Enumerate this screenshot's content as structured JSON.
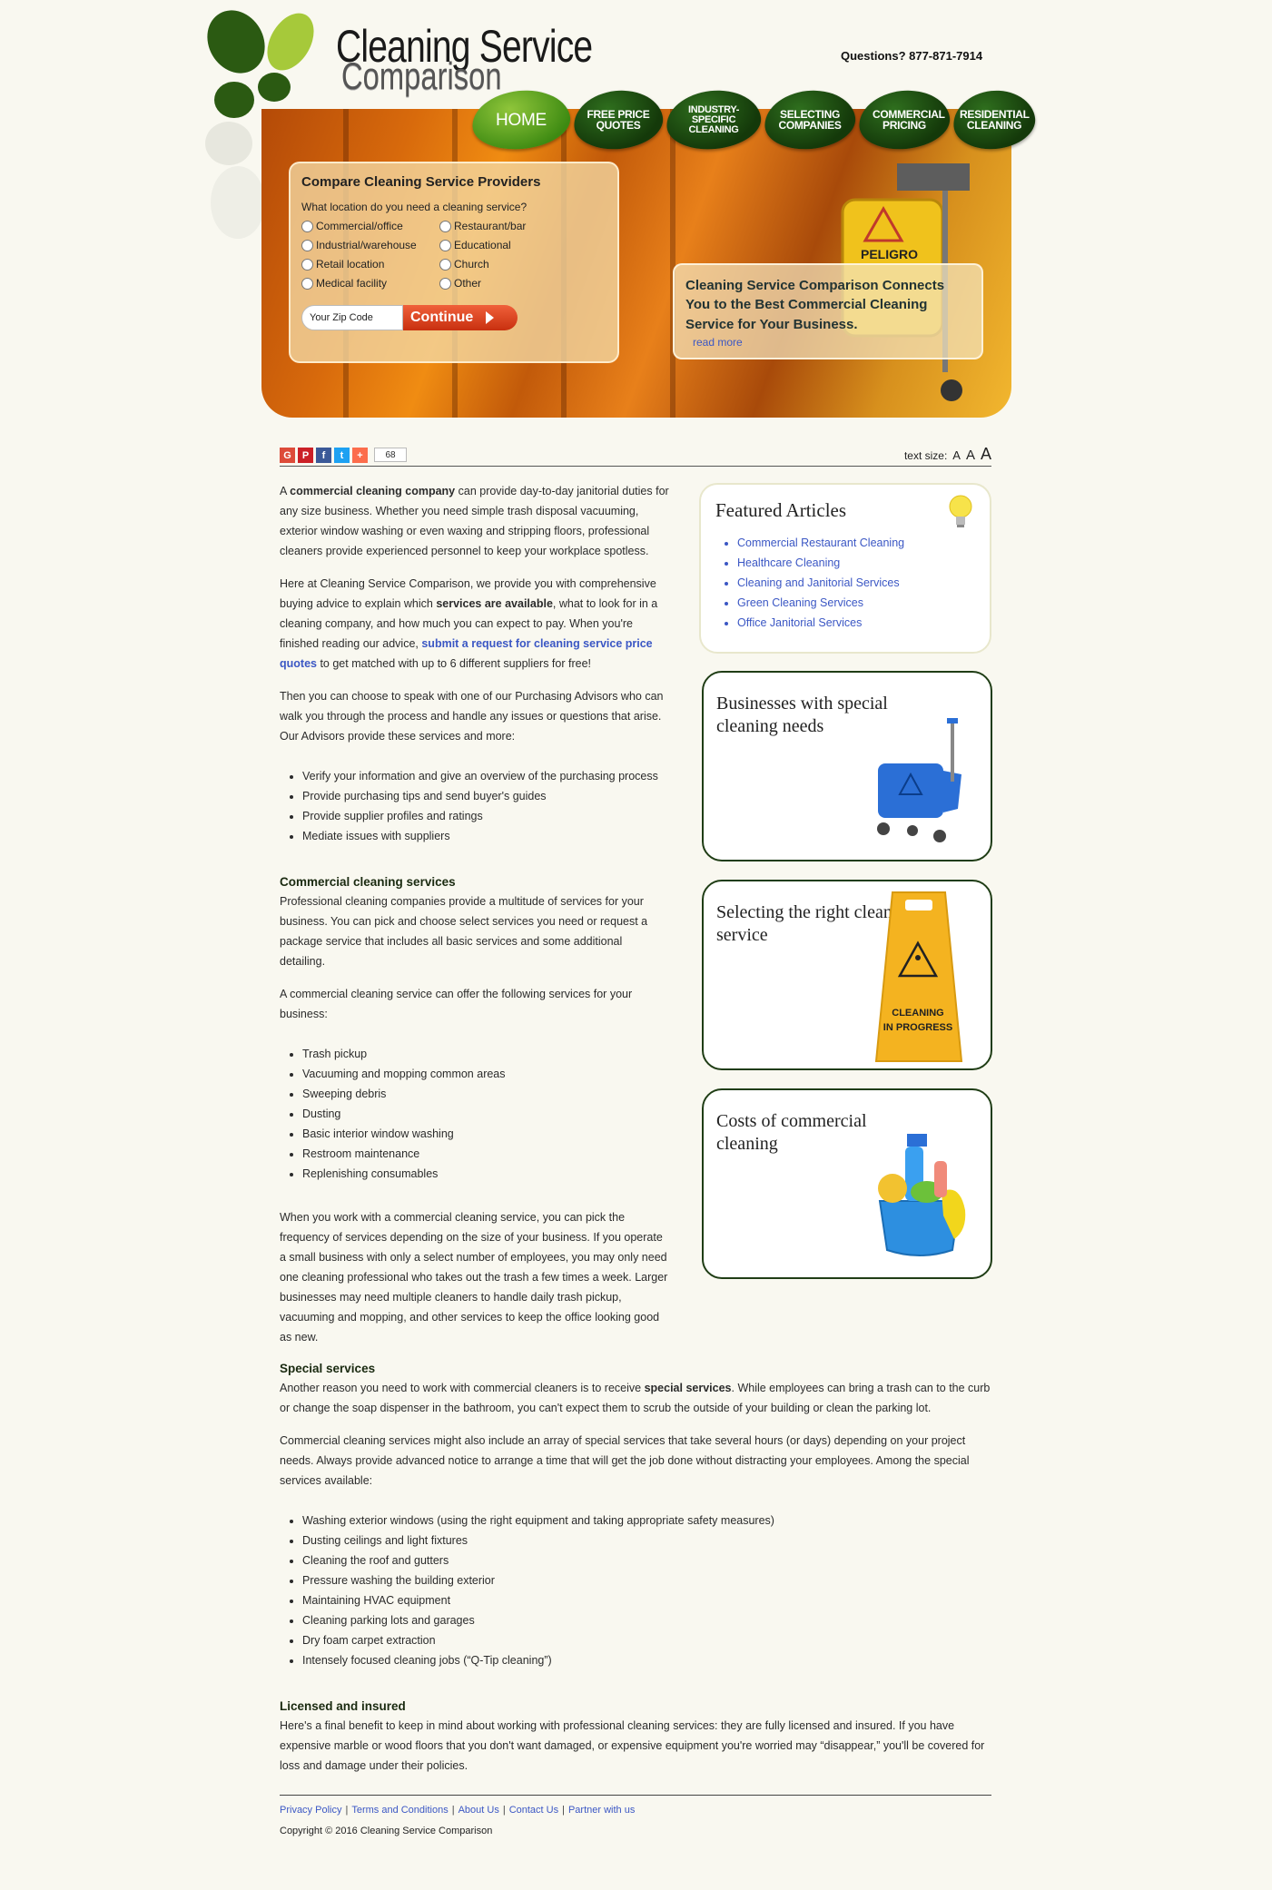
{
  "header": {
    "logo_line1": "Cleaning Service",
    "logo_line2": "Comparison",
    "phone_text": "Questions? 877-871-7914"
  },
  "nav": [
    {
      "label": "Home"
    },
    {
      "label": "Free Price Quotes"
    },
    {
      "label": "Industry-Specific Cleaning"
    },
    {
      "label": "Selecting Companies"
    },
    {
      "label": "Commercial Pricing"
    },
    {
      "label": "Residential Cleaning"
    }
  ],
  "compare_form": {
    "title": "Compare Cleaning Service Providers",
    "question": "What location do you need a cleaning service?",
    "options": [
      "Commercial/office",
      "Restaurant/bar",
      "Industrial/warehouse",
      "Educational",
      "Retail location",
      "Church",
      "Medical facility",
      "Other"
    ],
    "zip_placeholder": "Your Zip Code",
    "continue_label": "Continue"
  },
  "promo": {
    "text": "Cleaning Service Comparison Connects You to the Best Commercial Cleaning Service for Your Business.",
    "link": "read more"
  },
  "toolbar": {
    "share_count": "68",
    "text_size_label": "text size:",
    "sizes": [
      "A",
      "A",
      "A"
    ]
  },
  "article": {
    "p1_bold": "commercial cleaning company",
    "p1_pre": "A ",
    "p1_post": " can provide day-to-day janitorial duties for any size business. Whether you need simple trash disposal vacuuming, exterior window washing or even waxing and stripping floors, professional cleaners provide experienced personnel to keep your workplace spotless.",
    "p2_pre": "Here at Cleaning Service Comparison, we provide you with comprehensive buying advice to explain which ",
    "p2_bold": "services are available",
    "p2_mid": ", what to look for in a cleaning company, and how much you can expect to pay. When you're finished reading our advice, ",
    "p2_link": "submit a request for cleaning service price quotes",
    "p2_post": "  to get matched with up to 6 different suppliers for free!",
    "p3": "Then you can choose to speak with one of our Purchasing Advisors who can walk you through the process and handle any issues or questions that arise. Our Advisors provide these services and more:",
    "advisor_list": [
      "Verify your information and give an overview of the purchasing process",
      "Provide purchasing tips and send buyer's guides",
      "Provide supplier profiles and ratings",
      "Mediate issues with suppliers"
    ],
    "h_commercial": "Commercial cleaning services",
    "p4": "Professional cleaning companies provide a multitude of services for your business. You can pick and choose select services you need or request a package service that includes all basic services and some additional detailing.",
    "p5": "A commercial cleaning service can offer the following services for your business:",
    "services_list": [
      "Trash pickup",
      "Vacuuming and mopping common areas",
      "Sweeping debris",
      "Dusting",
      "Basic interior window washing",
      "Restroom maintenance",
      "Replenishing consumables"
    ],
    "p6": "When you work with a commercial cleaning service, you can pick the frequency of services depending on the size of your business. If you operate a small business with only a select number of employees, you may only need one cleaning professional who takes out the trash a few times a week. Larger businesses may need multiple cleaners to handle daily trash pickup, vacuuming and mopping, and other services to keep the office looking good as new.",
    "h_special": "Special services",
    "p7_pre": "Another reason you need to work with commercial cleaners is to receive ",
    "p7_bold": "special services",
    "p7_post": ". While employees can bring a trash can to the curb or change the soap dispenser in the bathroom, you can't expect them to scrub the outside of your building or clean the parking lot.",
    "p8": "Commercial cleaning services might also include an array of special services that take several hours (or days) depending on your project needs. Always provide advanced notice to arrange a time that will get the job done without distracting your employees. Among the special services available:",
    "special_list": [
      "Washing exterior windows (using the right equipment and taking appropriate safety measures)",
      "Dusting ceilings and light fixtures",
      "Cleaning the roof and gutters",
      "Pressure washing the building exterior",
      "Maintaining HVAC equipment",
      "Cleaning parking lots and garages",
      "Dry foam carpet extraction",
      "Intensely focused cleaning jobs (“Q-Tip cleaning”)"
    ],
    "h_licensed": "Licensed and insured",
    "p9": "Here's a final benefit to keep in mind about working with professional cleaning services: they are fully licensed and insured. If you have expensive marble or wood floors that you don't want damaged, or expensive equipment you're worried may “disappear,” you'll be covered for loss and damage under their policies."
  },
  "sidebar": {
    "featured_title": "Featured Articles",
    "featured_links": [
      "Commercial Restaurant Cleaning",
      "Healthcare Cleaning",
      "Cleaning and Janitorial Services",
      "Green Cleaning Services",
      "Office Janitorial Services"
    ],
    "cards": [
      {
        "title": "Businesses with special cleaning needs"
      },
      {
        "title": "Selecting the right cleaning service"
      },
      {
        "title": "Costs of commercial cleaning"
      }
    ],
    "sign_text_1": "CLEANING",
    "sign_text_2": "IN PROGRESS",
    "cart_sign": "PELIGRO"
  },
  "footer": {
    "links": [
      "Privacy Policy",
      "Terms and Conditions",
      "About Us",
      "Contact Us",
      "Partner with us"
    ],
    "copyright": "Copyright © 2016 Cleaning Service Comparison"
  },
  "colors": {
    "accent_green": "#1f3d15",
    "link_blue": "#3b57c4",
    "continue_red": "#d8401c"
  }
}
